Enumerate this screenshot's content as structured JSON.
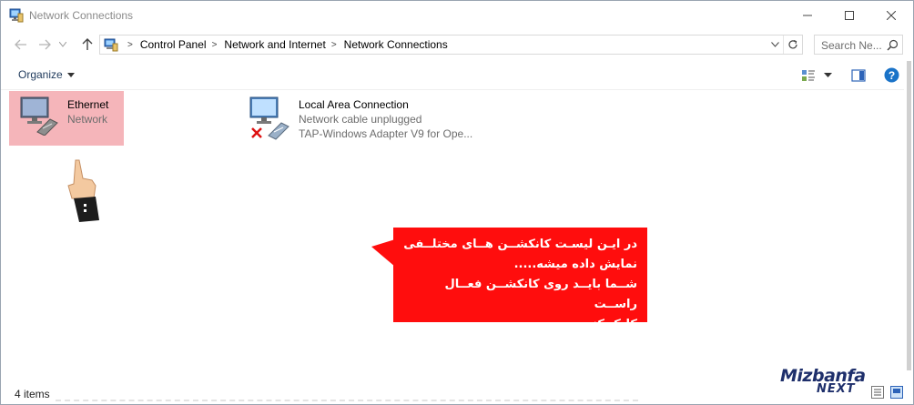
{
  "window": {
    "title": "Network Connections",
    "controls": {
      "minimize": "—",
      "maximize": "☐",
      "close": "✕"
    }
  },
  "address_bar": {
    "path": [
      "Control Panel",
      "Network and Internet",
      "Network Connections"
    ]
  },
  "search": {
    "placeholder": "Search Ne..."
  },
  "toolbar": {
    "organize_label": "Organize"
  },
  "connections": [
    {
      "name": "Ethernet",
      "status": "Network",
      "adapter": "",
      "selected": true
    },
    {
      "name": "Local Area Connection",
      "status": "Network cable unplugged",
      "adapter": "TAP-Windows Adapter V9 for Ope...",
      "selected": false
    }
  ],
  "callout": {
    "text": "در ایـن لیسـت کانکشــن هــای مختلــفی\nنمایش داده میشه.....\n شــما بایــد روی کانکشــن فعــال راســت\nکلیک کنید."
  },
  "status_bar": {
    "item_count": "4 items"
  },
  "watermark": {
    "brand": "Mizbanfa",
    "sub": "NEXT"
  },
  "colors": {
    "callout": "#ff0d0d",
    "selection": "#f5b5ba",
    "help_icon": "#1a73c8"
  }
}
